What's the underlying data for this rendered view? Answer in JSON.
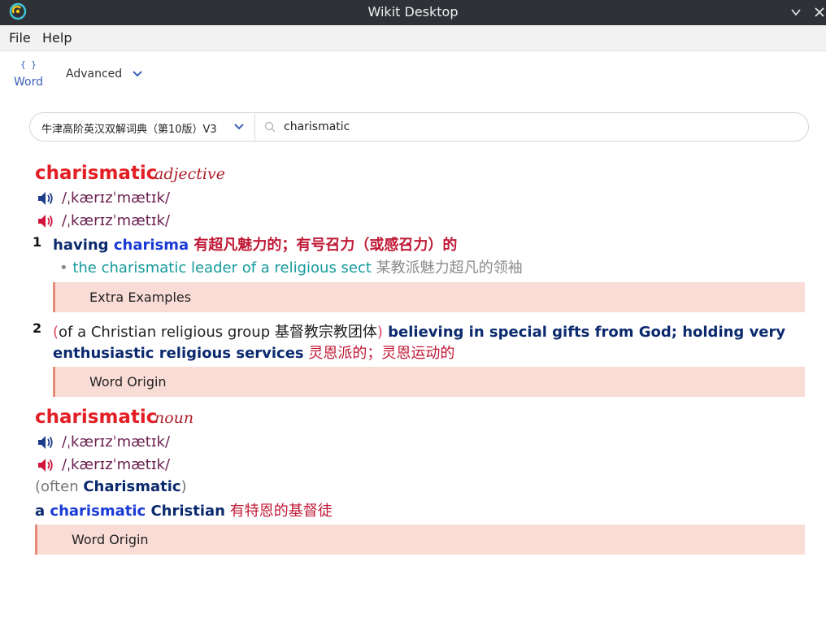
{
  "window": {
    "title": "Wikit Desktop",
    "app_icon": "wikit-logo-icon",
    "minimize_icon": "chevron-down-icon",
    "close_icon": "close-icon"
  },
  "menu": {
    "file": "File",
    "help": "Help"
  },
  "toolbar": {
    "word_icon": "{ }",
    "word_label": "Word",
    "advanced_label": "Advanced"
  },
  "search": {
    "dictionary": "牛津高阶英汉双解词典（第10版）V3",
    "value": "charismatic"
  },
  "colors": {
    "headword": "#e31e24",
    "speaker_uk": "#1f3c8c",
    "speaker_us": "#d0143c",
    "bar_bg": "#fadcd7",
    "bar_border": "#e88a78"
  },
  "entries": [
    {
      "headword": "charismatic",
      "pos": "adjective",
      "pron_uk": "/ˌkærɪzˈmætɪk/",
      "pron_us": "/ˌkærɪzˈmætɪk/",
      "senses": [
        {
          "num": "1",
          "def_en_a": "having ",
          "def_kw": "charisma",
          "def_zh": " 有超凡魅力的；有号召力（或感召力）的",
          "example_en": "the charismatic leader of a religious sect",
          "example_zh": " 某教派魅力超凡的领袖",
          "bar": "Extra Examples"
        },
        {
          "num": "2",
          "gram_open": "(",
          "gram_text": "of a Christian religious group 基督教宗教团体",
          "gram_close": ")",
          "def_en_line1": " believing in special gifts from God; holding very",
          "def_en_line2": "enthusiastic religious services",
          "def_zh": "  灵恩派的；灵恩运动的",
          "bar": "Word Origin"
        }
      ]
    },
    {
      "headword": "charismatic",
      "pos": "noun",
      "pron_uk": "/ˌkærɪzˈmætɪk/",
      "pron_us": "/ˌkærɪzˈmætɪk/",
      "often_open": "(often ",
      "often_kw": "Charismatic",
      "often_close": ")",
      "def_a": "a ",
      "def_kw": "charismatic",
      "def_b": " Christian",
      "def_zh": " 有特恩的基督徒",
      "bar": "Word Origin"
    }
  ]
}
